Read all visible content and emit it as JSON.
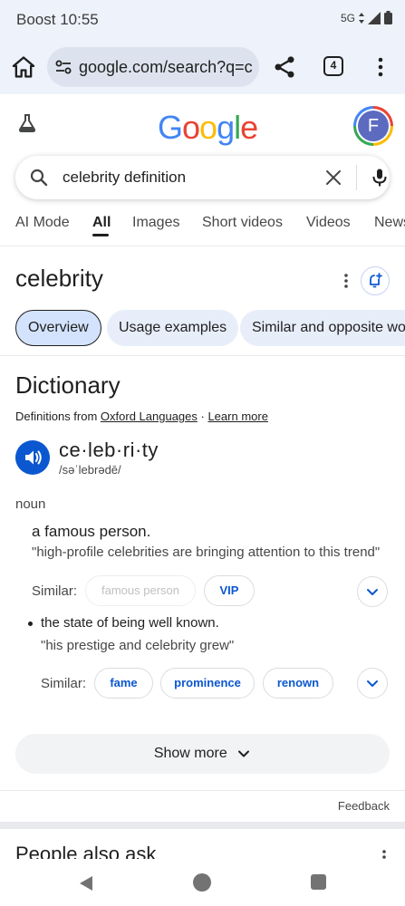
{
  "status_bar": {
    "carrier": "Boost",
    "time": "10:55",
    "network": "5G"
  },
  "browser": {
    "url": "google.com/search?q=c",
    "tab_count": "4"
  },
  "google": {
    "logo_letters": [
      "G",
      "o",
      "o",
      "g",
      "l",
      "e"
    ],
    "logo_colors": [
      "#4285f4",
      "#ea4335",
      "#fbbc04",
      "#4285f4",
      "#34a853",
      "#ea4335"
    ],
    "avatar_letter": "F",
    "query": "celebrity definition"
  },
  "tabs": [
    "AI Mode",
    "All",
    "Images",
    "Short videos",
    "Videos",
    "News"
  ],
  "active_tab": "All",
  "entity": {
    "title": "celebrity"
  },
  "chips": [
    "Overview",
    "Usage examples",
    "Similar and opposite words"
  ],
  "dictionary": {
    "heading": "Dictionary",
    "source_prefix": "Definitions from ",
    "source_name": "Oxford Languages",
    "source_sep": " · ",
    "learn_more": "Learn more",
    "word": "ce·leb·ri·ty",
    "phonetic": "/səˈlebrədē/",
    "part_of_speech": "noun",
    "definitions": [
      {
        "text": "a famous person.",
        "example": "\"high-profile celebrities are bringing attention to this trend\"",
        "similar_label": "Similar:",
        "similar": [
          "famous person",
          "VIP"
        ]
      },
      {
        "text": "the state of being well known.",
        "example": "\"his prestige and celebrity grew\"",
        "similar_label": "Similar:",
        "similar": [
          "fame",
          "prominence",
          "renown"
        ]
      }
    ],
    "show_more": "Show more"
  },
  "feedback": "Feedback",
  "people_also_ask": "People also ask",
  "colors": {
    "accent_blue": "#0b57d0",
    "chrome_bg": "#eef2fa"
  }
}
